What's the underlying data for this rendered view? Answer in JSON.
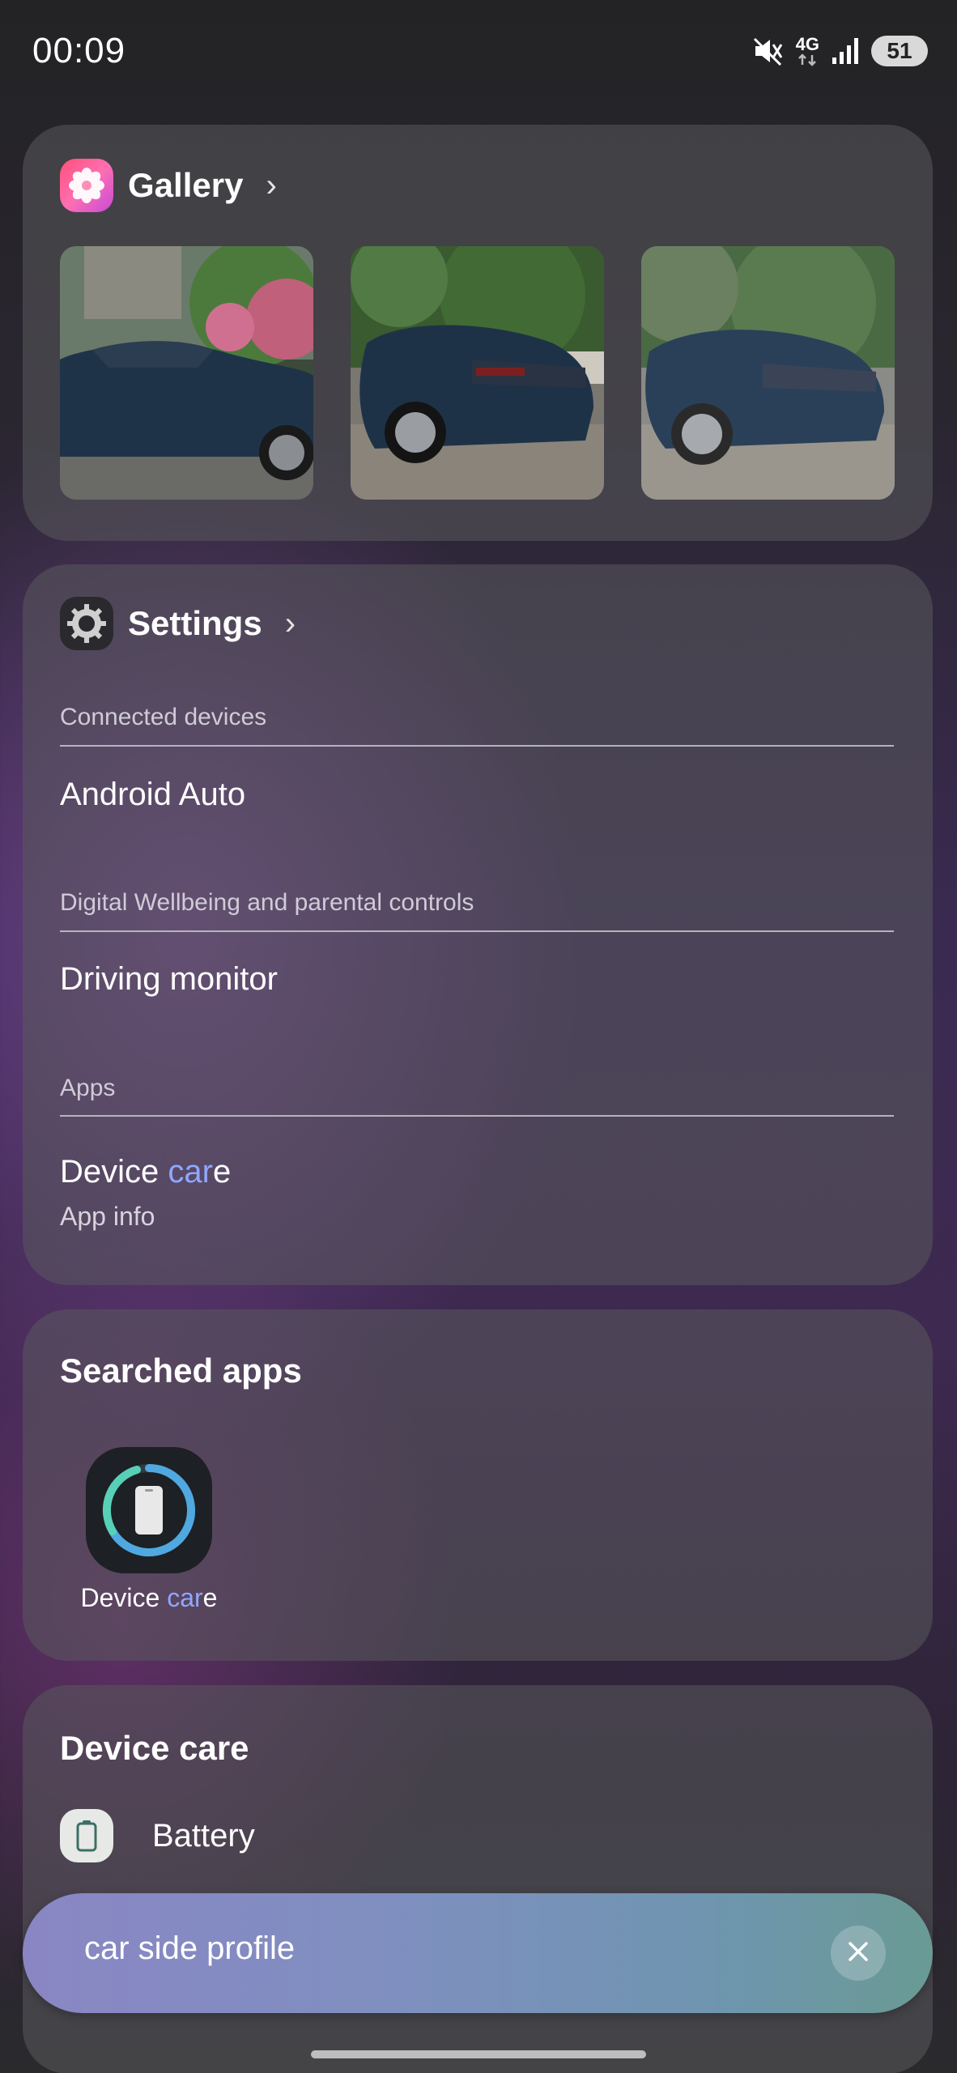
{
  "status_bar": {
    "time": "00:09",
    "network": "4G",
    "battery": "51",
    "icons": [
      "mute-icon",
      "network-4g-icon",
      "signal-icon",
      "battery-icon"
    ]
  },
  "gallery": {
    "title": "Gallery",
    "icon": "gallery-flower-icon",
    "chevron": "›",
    "photos": [
      "car-front-side-photo",
      "car-rear-photo",
      "car-rear-blurred-photo"
    ]
  },
  "settings": {
    "title": "Settings",
    "icon": "gear-icon",
    "chevron": "›",
    "sections": [
      {
        "label": "Connected devices",
        "item": "Android Auto"
      },
      {
        "label": "Digital Wellbeing and parental controls",
        "item": "Driving monitor"
      },
      {
        "label": "Apps",
        "item_prefix": "Device ",
        "item_highlight": "car",
        "item_suffix": "e",
        "subtitle": "App info"
      }
    ]
  },
  "searched_apps": {
    "title": "Searched apps",
    "apps": [
      {
        "prefix": "Device ",
        "highlight": "car",
        "suffix": "e",
        "icon": "device-care-icon"
      }
    ]
  },
  "device_care": {
    "title": "Device care",
    "items": [
      {
        "label": "Battery",
        "icon": "battery-icon"
      }
    ]
  },
  "search": {
    "query": "car side profile",
    "clear_icon": "close-icon"
  },
  "colors": {
    "highlight": "#8fa7ff",
    "card": "#5a5a5c",
    "search_bar_start": "#8a86c4",
    "search_bar_end": "#6a9a94"
  }
}
